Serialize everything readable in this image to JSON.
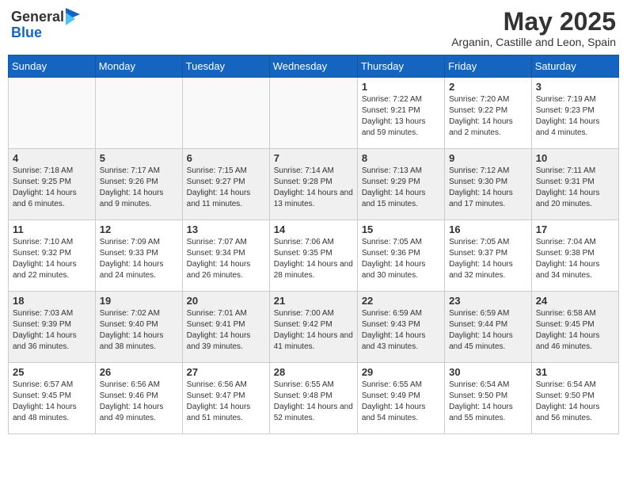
{
  "header": {
    "logo_general": "General",
    "logo_blue": "Blue",
    "month_year": "May 2025",
    "location": "Arganin, Castille and Leon, Spain"
  },
  "days_of_week": [
    "Sunday",
    "Monday",
    "Tuesday",
    "Wednesday",
    "Thursday",
    "Friday",
    "Saturday"
  ],
  "weeks": [
    [
      {
        "day": "",
        "content": ""
      },
      {
        "day": "",
        "content": ""
      },
      {
        "day": "",
        "content": ""
      },
      {
        "day": "",
        "content": ""
      },
      {
        "day": "1",
        "content": "Sunrise: 7:22 AM\nSunset: 9:21 PM\nDaylight: 13 hours and 59 minutes."
      },
      {
        "day": "2",
        "content": "Sunrise: 7:20 AM\nSunset: 9:22 PM\nDaylight: 14 hours and 2 minutes."
      },
      {
        "day": "3",
        "content": "Sunrise: 7:19 AM\nSunset: 9:23 PM\nDaylight: 14 hours and 4 minutes."
      }
    ],
    [
      {
        "day": "4",
        "content": "Sunrise: 7:18 AM\nSunset: 9:25 PM\nDaylight: 14 hours and 6 minutes."
      },
      {
        "day": "5",
        "content": "Sunrise: 7:17 AM\nSunset: 9:26 PM\nDaylight: 14 hours and 9 minutes."
      },
      {
        "day": "6",
        "content": "Sunrise: 7:15 AM\nSunset: 9:27 PM\nDaylight: 14 hours and 11 minutes."
      },
      {
        "day": "7",
        "content": "Sunrise: 7:14 AM\nSunset: 9:28 PM\nDaylight: 14 hours and 13 minutes."
      },
      {
        "day": "8",
        "content": "Sunrise: 7:13 AM\nSunset: 9:29 PM\nDaylight: 14 hours and 15 minutes."
      },
      {
        "day": "9",
        "content": "Sunrise: 7:12 AM\nSunset: 9:30 PM\nDaylight: 14 hours and 17 minutes."
      },
      {
        "day": "10",
        "content": "Sunrise: 7:11 AM\nSunset: 9:31 PM\nDaylight: 14 hours and 20 minutes."
      }
    ],
    [
      {
        "day": "11",
        "content": "Sunrise: 7:10 AM\nSunset: 9:32 PM\nDaylight: 14 hours and 22 minutes."
      },
      {
        "day": "12",
        "content": "Sunrise: 7:09 AM\nSunset: 9:33 PM\nDaylight: 14 hours and 24 minutes."
      },
      {
        "day": "13",
        "content": "Sunrise: 7:07 AM\nSunset: 9:34 PM\nDaylight: 14 hours and 26 minutes."
      },
      {
        "day": "14",
        "content": "Sunrise: 7:06 AM\nSunset: 9:35 PM\nDaylight: 14 hours and 28 minutes."
      },
      {
        "day": "15",
        "content": "Sunrise: 7:05 AM\nSunset: 9:36 PM\nDaylight: 14 hours and 30 minutes."
      },
      {
        "day": "16",
        "content": "Sunrise: 7:05 AM\nSunset: 9:37 PM\nDaylight: 14 hours and 32 minutes."
      },
      {
        "day": "17",
        "content": "Sunrise: 7:04 AM\nSunset: 9:38 PM\nDaylight: 14 hours and 34 minutes."
      }
    ],
    [
      {
        "day": "18",
        "content": "Sunrise: 7:03 AM\nSunset: 9:39 PM\nDaylight: 14 hours and 36 minutes."
      },
      {
        "day": "19",
        "content": "Sunrise: 7:02 AM\nSunset: 9:40 PM\nDaylight: 14 hours and 38 minutes."
      },
      {
        "day": "20",
        "content": "Sunrise: 7:01 AM\nSunset: 9:41 PM\nDaylight: 14 hours and 39 minutes."
      },
      {
        "day": "21",
        "content": "Sunrise: 7:00 AM\nSunset: 9:42 PM\nDaylight: 14 hours and 41 minutes."
      },
      {
        "day": "22",
        "content": "Sunrise: 6:59 AM\nSunset: 9:43 PM\nDaylight: 14 hours and 43 minutes."
      },
      {
        "day": "23",
        "content": "Sunrise: 6:59 AM\nSunset: 9:44 PM\nDaylight: 14 hours and 45 minutes."
      },
      {
        "day": "24",
        "content": "Sunrise: 6:58 AM\nSunset: 9:45 PM\nDaylight: 14 hours and 46 minutes."
      }
    ],
    [
      {
        "day": "25",
        "content": "Sunrise: 6:57 AM\nSunset: 9:45 PM\nDaylight: 14 hours and 48 minutes."
      },
      {
        "day": "26",
        "content": "Sunrise: 6:56 AM\nSunset: 9:46 PM\nDaylight: 14 hours and 49 minutes."
      },
      {
        "day": "27",
        "content": "Sunrise: 6:56 AM\nSunset: 9:47 PM\nDaylight: 14 hours and 51 minutes."
      },
      {
        "day": "28",
        "content": "Sunrise: 6:55 AM\nSunset: 9:48 PM\nDaylight: 14 hours and 52 minutes."
      },
      {
        "day": "29",
        "content": "Sunrise: 6:55 AM\nSunset: 9:49 PM\nDaylight: 14 hours and 54 minutes."
      },
      {
        "day": "30",
        "content": "Sunrise: 6:54 AM\nSunset: 9:50 PM\nDaylight: 14 hours and 55 minutes."
      },
      {
        "day": "31",
        "content": "Sunrise: 6:54 AM\nSunset: 9:50 PM\nDaylight: 14 hours and 56 minutes."
      }
    ]
  ]
}
